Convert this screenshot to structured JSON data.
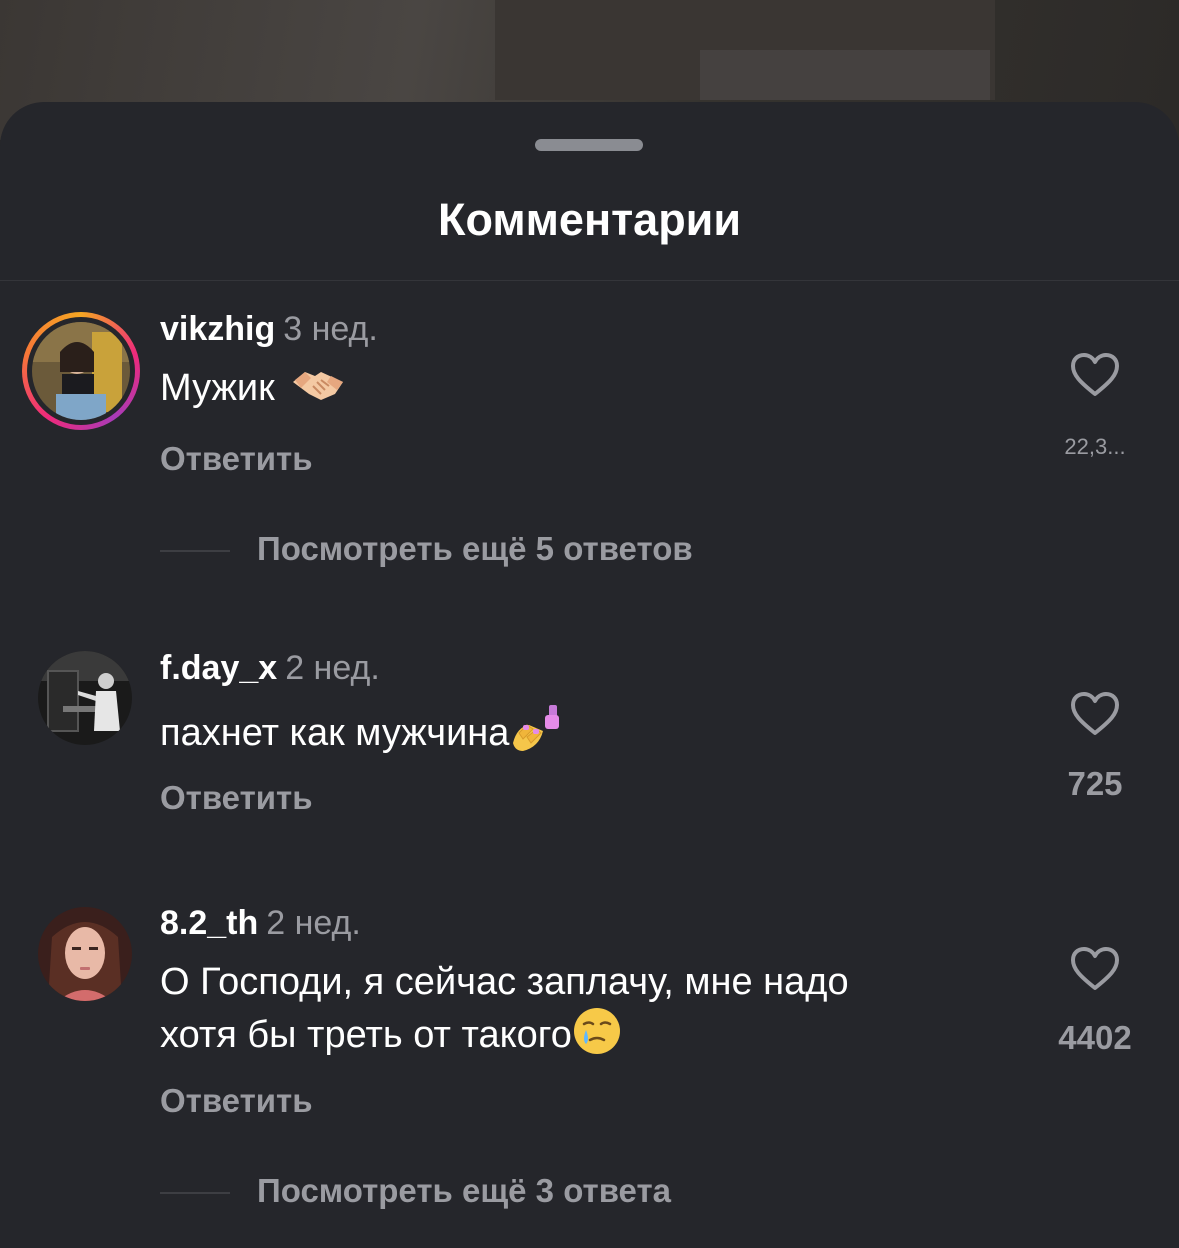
{
  "sheet": {
    "title": "Комментарии"
  },
  "comments": [
    {
      "username": "vikzhig",
      "age": "3 нед.",
      "text": "Мужик",
      "emoji": "handshake",
      "reply_label": "Ответить",
      "likes": "22,3...",
      "has_story_ring": true,
      "more_replies": "Посмотреть ещё 5 ответов"
    },
    {
      "username": "f.day_x",
      "age": "2 нед.",
      "text": "пахнет как мужчина",
      "emoji": "nail-polish",
      "reply_label": "Ответить",
      "likes": "725",
      "has_story_ring": false
    },
    {
      "username": "8.2_th",
      "age": "2 нед.",
      "text_line1": "О Господи, я сейчас заплачу, мне надо",
      "text_line2": "хотя бы треть от такого",
      "emoji": "face-holding-back-tears",
      "reply_label": "Ответить",
      "likes": "4402",
      "has_story_ring": false,
      "more_replies": "Посмотреть ещё 3 ответа"
    }
  ],
  "colors": {
    "sheet_bg": "#25262b",
    "text_primary": "#ffffff",
    "text_secondary": "#9a9ba1"
  }
}
